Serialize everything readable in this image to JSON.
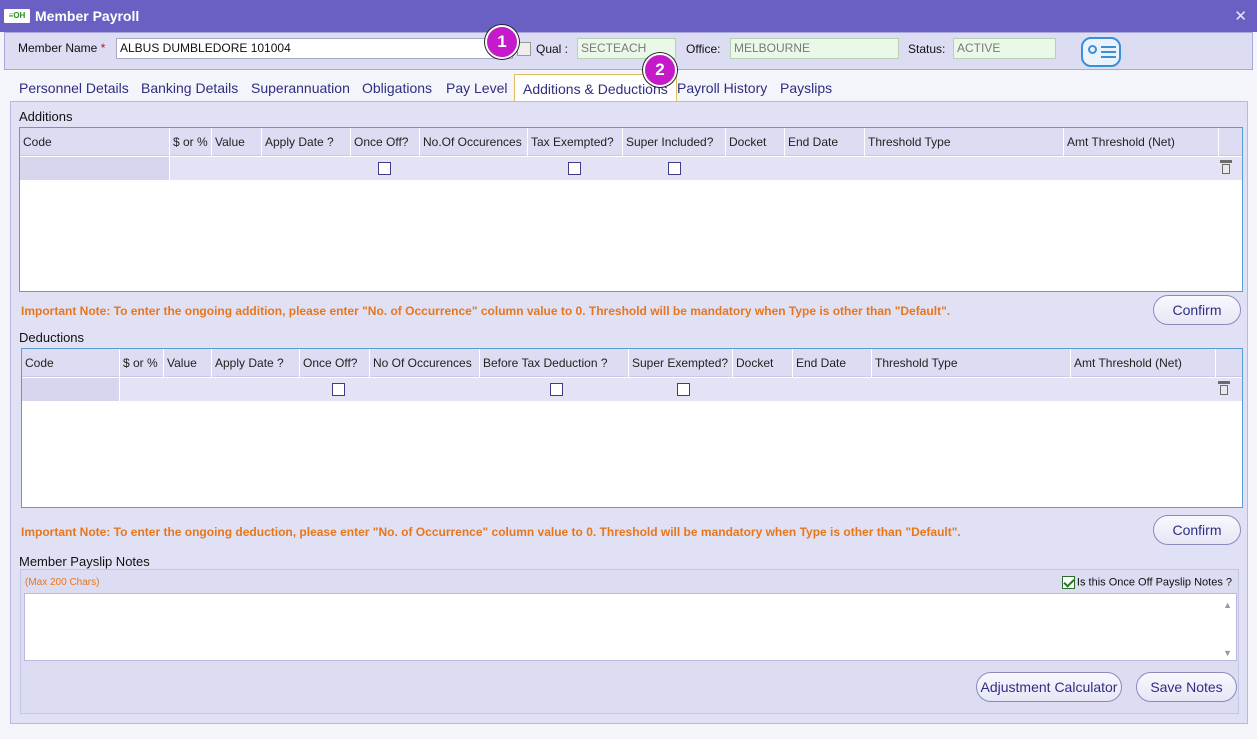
{
  "window": {
    "app_logo": "≡OH",
    "title": "Member Payroll",
    "close": "✕"
  },
  "member": {
    "name_label": "Member Name",
    "required_mark": "*",
    "name_value": "ALBUS DUMBLEDORE 101004",
    "qual_label": "Qual :",
    "qual_value": "SECTEACH",
    "office_label": "Office:",
    "office_value": "MELBOURNE",
    "status_label": "Status:",
    "status_value": "ACTIVE"
  },
  "callouts": [
    "1",
    "2"
  ],
  "tabs": [
    {
      "label": "Personnel Details"
    },
    {
      "label": "Banking Details"
    },
    {
      "label": "Superannuation"
    },
    {
      "label": "Obligations"
    },
    {
      "label": "Pay Level"
    },
    {
      "label": "Additions & Deductions",
      "active": true
    },
    {
      "label": "Payroll History"
    },
    {
      "label": "Payslips"
    }
  ],
  "additions": {
    "title": "Additions",
    "columns": [
      "Code",
      "$ or %",
      "Value",
      "Apply Date ?",
      "Once Off?",
      "No.Of Occurences",
      "Tax Exempted?",
      "Super Included?",
      "Docket",
      "End Date",
      "Threshold Type",
      "Amt Threshold (Net)"
    ],
    "note": "Important Note: To enter the ongoing addition, please enter \"No. of Occurrence\" column value to 0. Threshold will be mandatory when Type is other than \"Default\".",
    "confirm_label": "Confirm"
  },
  "deductions": {
    "title": "Deductions",
    "columns": [
      "Code",
      "$ or %",
      "Value",
      "Apply Date ?",
      "Once Off?",
      "No Of Occurences",
      "Before Tax Deduction ?",
      "Super Exempted?",
      "Docket",
      "End Date",
      "Threshold Type",
      "Amt Threshold (Net)"
    ],
    "note": "Important Note: To enter the ongoing deduction, please enter \"No. of Occurrence\" column value to 0.  Threshold will be mandatory when Type is other than \"Default\".",
    "confirm_label": "Confirm"
  },
  "payslip_notes": {
    "title": "Member Payslip Notes",
    "max_chars": "(Max 200 Chars)",
    "once_off_label": "Is this Once Off Payslip Notes ?",
    "once_off_checked": true,
    "value": ""
  },
  "buttons": {
    "adjustment_calculator": "Adjustment Calculator",
    "save_notes": "Save Notes"
  },
  "colors": {
    "titlebar": "#6a60c3",
    "note_orange": "#e8761a",
    "badge": "#c51ac9",
    "grid_border": "#5a9bd5"
  }
}
